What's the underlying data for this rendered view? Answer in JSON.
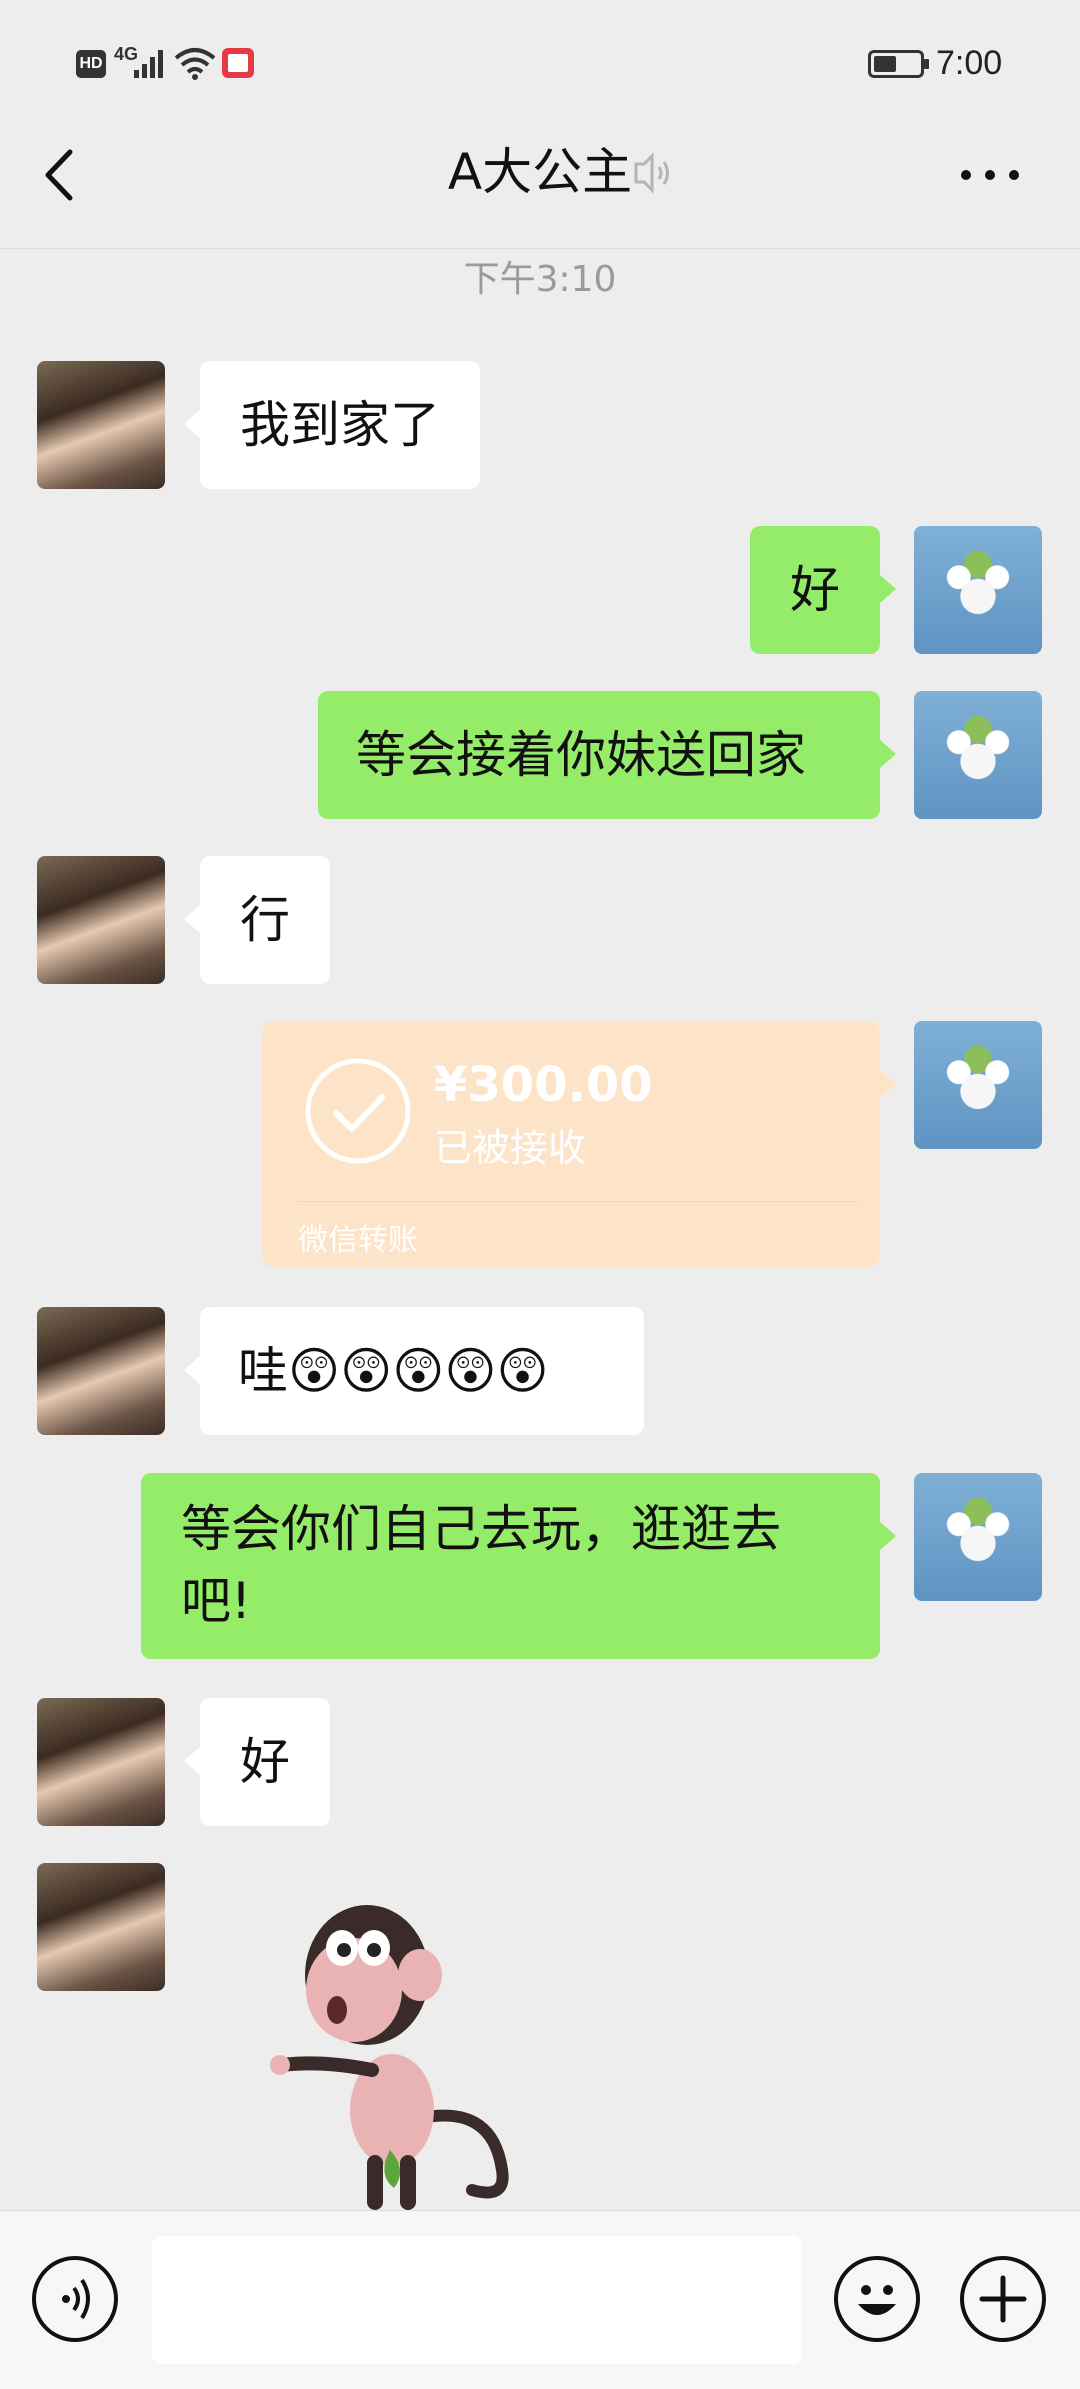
{
  "status_bar": {
    "hd_label": "HD",
    "network_label": "4G",
    "time": "7:00"
  },
  "header": {
    "title": "A大公主"
  },
  "chat": {
    "timestamp": "下午3:10",
    "messages": [
      {
        "side": "in",
        "type": "text",
        "text": "我到家了"
      },
      {
        "side": "out",
        "type": "text",
        "text": "好"
      },
      {
        "side": "out",
        "type": "text",
        "text": "等会接着你妹送回家"
      },
      {
        "side": "in",
        "type": "text",
        "text": "行"
      },
      {
        "side": "out",
        "type": "transfer",
        "amount": "¥300.00",
        "status": "已被接收",
        "footer": "微信转账"
      },
      {
        "side": "in",
        "type": "text",
        "text": "哇😲😲😲😲😲"
      },
      {
        "side": "out",
        "type": "text",
        "text_line1": "等会你们自己去玩，逛逛去",
        "text_line2": "吧!"
      },
      {
        "side": "in",
        "type": "text",
        "text": "好"
      },
      {
        "side": "in",
        "type": "sticker",
        "sticker_icon": "monkey-sticker-icon"
      }
    ]
  },
  "input_bar": {
    "placeholder": ""
  },
  "colors": {
    "background": "#ededed",
    "outgoing_bubble": "#95ec69",
    "incoming_bubble": "#ffffff",
    "transfer_card": "#fde3c7"
  }
}
